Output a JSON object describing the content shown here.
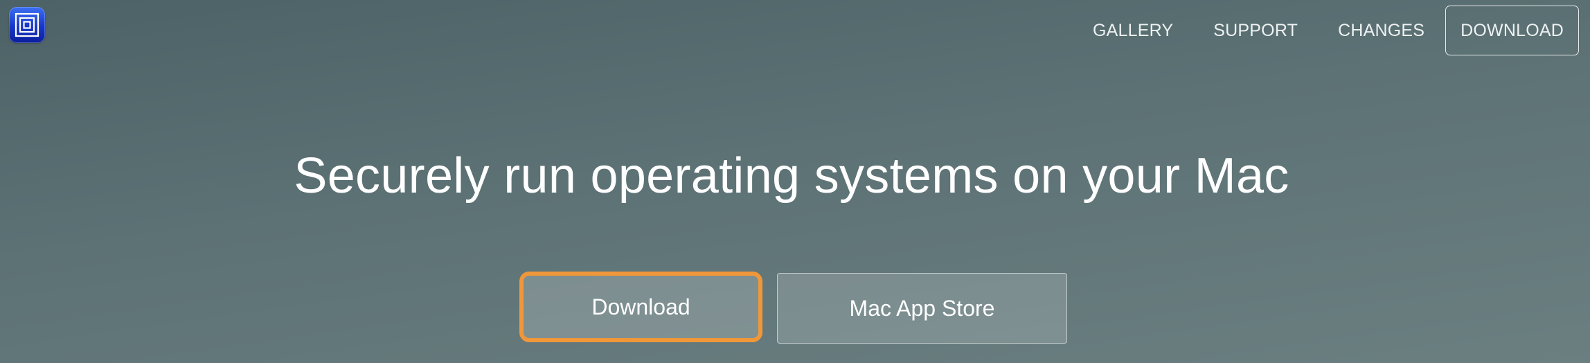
{
  "header": {
    "logo_icon": "utm-logo-icon",
    "nav": {
      "items": [
        {
          "label": "GALLERY"
        },
        {
          "label": "SUPPORT"
        },
        {
          "label": "CHANGES"
        }
      ],
      "cta_label": "DOWNLOAD"
    }
  },
  "hero": {
    "headline": "Securely run operating systems on your Mac",
    "buttons": {
      "download_label": "Download",
      "app_store_label": "Mac App Store"
    },
    "highlight_color": "#f0973a"
  }
}
